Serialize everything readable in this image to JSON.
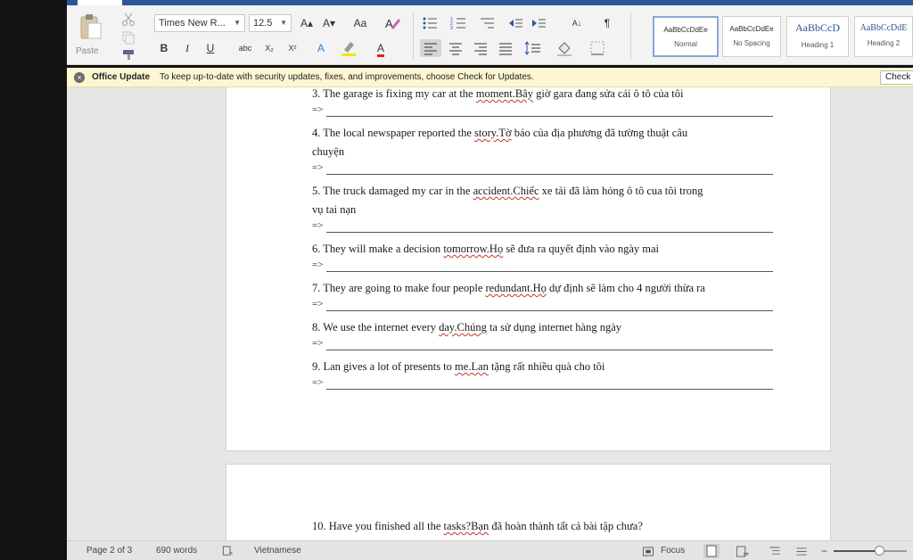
{
  "ribbon": {
    "paste_label": "Paste",
    "font_name": "Times New R...",
    "font_size": "12.5",
    "bold_label": "B",
    "italic_label": "I",
    "underline_label": "U",
    "strike_label": "abc",
    "subscript_label": "X₂",
    "superscript_label": "X²",
    "grow_label": "A▴",
    "shrink_label": "A▾",
    "case_label": "Aa",
    "text_effects_label": "A",
    "font_color_label": "A",
    "pilcrow_label": "¶",
    "sort_label": "A↓",
    "styles": [
      {
        "sample": "AaBbCcDdEe",
        "name": "Normal"
      },
      {
        "sample": "AaBbCcDdEe",
        "name": "No Spacing"
      },
      {
        "sample": "AaBbCcD",
        "name": "Heading 1"
      },
      {
        "sample": "AaBbCcDdE",
        "name": "Heading 2"
      }
    ]
  },
  "update_bar": {
    "title": "Office Update",
    "message": "To keep up-to-date with security updates, fixes, and improvements, choose Check for Updates.",
    "button": "Check for Updates"
  },
  "document": {
    "arrow": "=>",
    "items": [
      {
        "lines": [
          [
            "3. The garage is fixing my car at the ",
            "moment.Bây",
            " giờ gara đang sửa cái ô tô của tôi"
          ]
        ]
      },
      {
        "lines": [
          [
            "4. The local newspaper reported the ",
            "story.Tờ",
            " báo của địa phương đã tường thuật câu"
          ],
          [
            "chuyện",
            "",
            ""
          ]
        ]
      },
      {
        "lines": [
          [
            "5. The truck damaged my car in the ",
            "accident.Chiếc",
            " xe tải đã làm hỏng ô tô cua tôi trong"
          ],
          [
            "vụ tai nạn",
            "",
            ""
          ]
        ]
      },
      {
        "lines": [
          [
            "6. They will make a decision ",
            "tomorrow.Họ",
            " sẽ đưa ra quyết định vào ngày mai"
          ]
        ]
      },
      {
        "lines": [
          [
            "7. They are going to make four people ",
            "redundant.Họ",
            " dự định sẽ làm cho 4 người thừa ra"
          ]
        ]
      },
      {
        "lines": [
          [
            "8. We use the internet every ",
            "day.Chúng",
            " ta sử dụng internet hàng ngày"
          ]
        ]
      },
      {
        "lines": [
          [
            "9. Lan gives a lot of presents to ",
            "me.Lan",
            " tặng rất nhiều quà cho tôi"
          ]
        ]
      }
    ],
    "page2_line": [
      "10. Have you finished all the ",
      "tasks?Bạn",
      " đã hoàn thành tất cả bài tập chưa?"
    ]
  },
  "status": {
    "page": "Page 2 of 3",
    "words": "690 words",
    "language": "Vietnamese",
    "focus": "Focus"
  },
  "zoom": {
    "level": 0.62
  },
  "colors": {
    "ribbon_tab": "#2b579a",
    "update_bar": "#fdf6d2",
    "canvas": "#e6e6e6",
    "accent": "#2e5597"
  }
}
